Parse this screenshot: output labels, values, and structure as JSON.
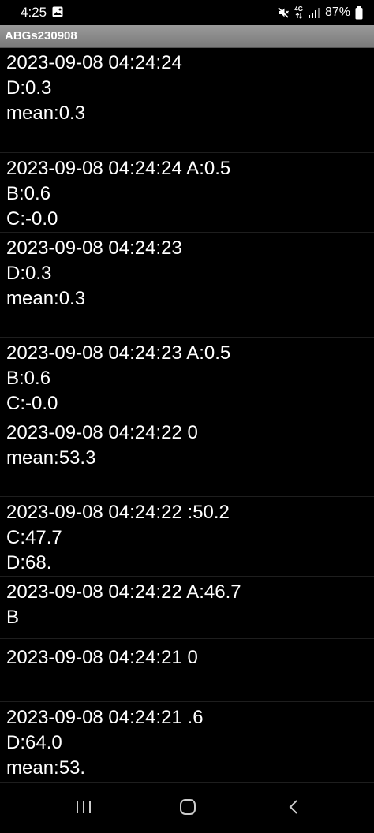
{
  "status_bar": {
    "time": "4:25",
    "network": "4G",
    "battery": "87%"
  },
  "app": {
    "title": "ABGs230908"
  },
  "log": {
    "entries": [
      {
        "lines": [
          "2023-09-08 04:24:24",
          "D:0.3",
          "mean:0.3"
        ]
      },
      {
        "lines": [
          "2023-09-08 04:24:24 A:0.5",
          "B:0.6",
          "C:-0.0"
        ]
      },
      {
        "lines": [
          "2023-09-08 04:24:23",
          "D:0.3",
          "mean:0.3"
        ]
      },
      {
        "lines": [
          "2023-09-08 04:24:23 A:0.5",
          "B:0.6",
          "C:-0.0"
        ]
      },
      {
        "lines": [
          "2023-09-08 04:24:22 0",
          "mean:53.3"
        ]
      },
      {
        "lines": [
          "2023-09-08 04:24:22 :50.2",
          "C:47.7",
          "D:68."
        ]
      },
      {
        "lines": [
          "2023-09-08 04:24:22 A:46.7",
          "B"
        ]
      },
      {
        "lines": [
          "2023-09-08 04:24:21 0"
        ]
      },
      {
        "lines": [
          "2023-09-08 04:24:21 .6",
          "D:64.0",
          "mean:53."
        ]
      }
    ]
  },
  "colors": {
    "background": "#000000",
    "text": "#ffffff",
    "title_bar": "#8a8a8a"
  },
  "icons": {
    "status_left": "gallery-icon",
    "status_right": [
      "mute-icon",
      "network-4g-icon",
      "signal-icon",
      "battery-icon"
    ],
    "nav": [
      "recent-apps-icon",
      "home-icon",
      "back-icon"
    ]
  }
}
